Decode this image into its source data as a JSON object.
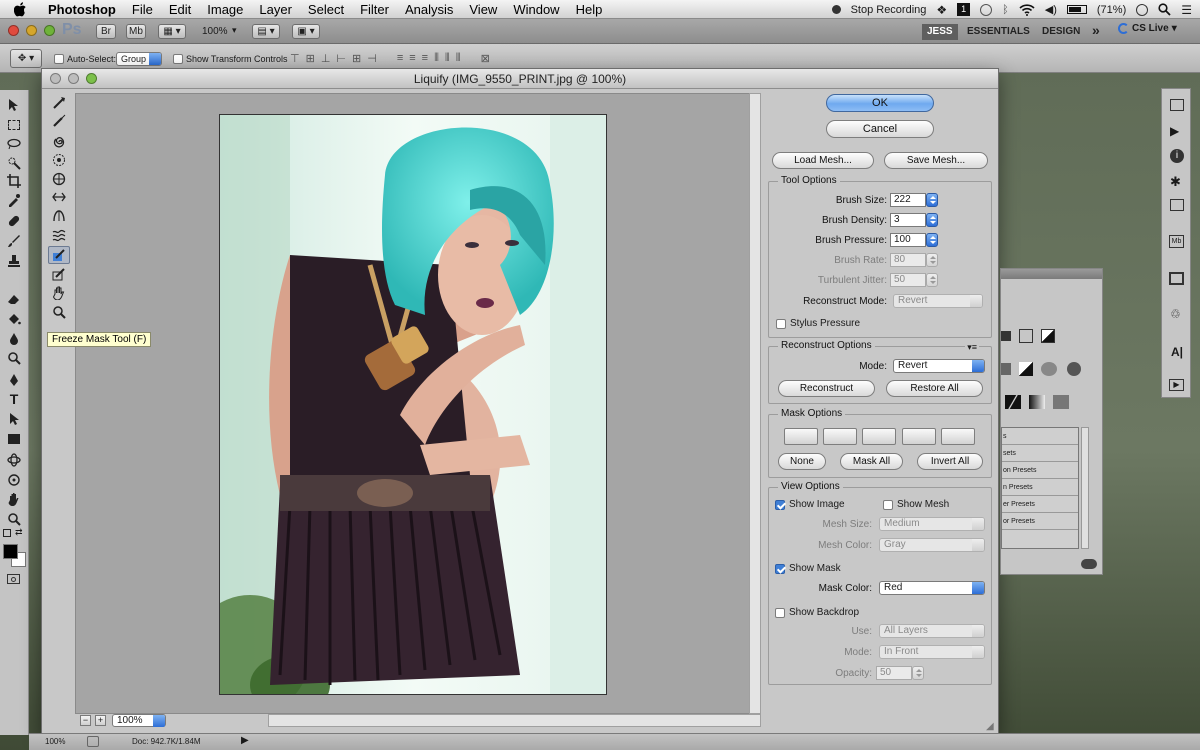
{
  "menubar": {
    "app_name": "Photoshop",
    "items": [
      "File",
      "Edit",
      "Image",
      "Layer",
      "Select",
      "Filter",
      "Analysis",
      "View",
      "Window",
      "Help"
    ],
    "stop_recording": "Stop Recording",
    "battery": "(71%)"
  },
  "appbar": {
    "ps_logo": "Ps",
    "br_label": "Br",
    "mb_label": "Mb",
    "zoom": "100%",
    "workspaces": [
      "JESS",
      "ESSENTIALS",
      "DESIGN"
    ],
    "more": "»",
    "cs_live": "CS Live"
  },
  "options": {
    "auto_select": "Auto-Select:",
    "group_value": "Group",
    "show_transform": "Show Transform Controls"
  },
  "dialog": {
    "title": "Liquify (IMG_9550_PRINT.jpg @ 100%)",
    "tooltip": "Freeze Mask Tool (F)",
    "zoom_value": "100%",
    "ok": "OK",
    "cancel": "Cancel",
    "load_mesh": "Load Mesh...",
    "save_mesh": "Save Mesh...",
    "tool_options": {
      "legend": "Tool Options",
      "brush_size_label": "Brush Size:",
      "brush_size": "222",
      "brush_density_label": "Brush Density:",
      "brush_density": "3",
      "brush_pressure_label": "Brush Pressure:",
      "brush_pressure": "100",
      "brush_rate_label": "Brush Rate:",
      "brush_rate": "80",
      "turbulent_jitter_label": "Turbulent Jitter:",
      "turbulent_jitter": "50",
      "reconstruct_mode_label": "Reconstruct Mode:",
      "reconstruct_mode": "Revert",
      "stylus_pressure": "Stylus Pressure"
    },
    "reconstruct_options": {
      "legend": "Reconstruct Options",
      "mode_label": "Mode:",
      "mode": "Revert",
      "reconstruct": "Reconstruct",
      "restore_all": "Restore All"
    },
    "mask_options": {
      "legend": "Mask Options",
      "none": "None",
      "mask_all": "Mask All",
      "invert_all": "Invert All"
    },
    "view_options": {
      "legend": "View Options",
      "show_image": "Show Image",
      "show_mesh": "Show Mesh",
      "mesh_size_label": "Mesh Size:",
      "mesh_size": "Medium",
      "mesh_color_label": "Mesh Color:",
      "mesh_color": "Gray",
      "show_mask": "Show Mask",
      "mask_color_label": "Mask Color:",
      "mask_color": "Red",
      "show_backdrop": "Show Backdrop",
      "use_label": "Use:",
      "use": "All Layers",
      "mode_label": "Mode:",
      "mode": "In Front",
      "opacity_label": "Opacity:",
      "opacity": "50"
    }
  },
  "status": {
    "zoom": "100%",
    "doc": "Doc: 942.7K/1.84M"
  },
  "side_panel": {
    "items": [
      "s",
      "sets",
      "on Presets",
      "n Presets",
      "er Presets",
      "or Presets"
    ]
  },
  "colors": {
    "accent_blue": "#3f7fd6",
    "hair": "#4fd3cf",
    "tooltip_bg": "#ffffcf"
  }
}
